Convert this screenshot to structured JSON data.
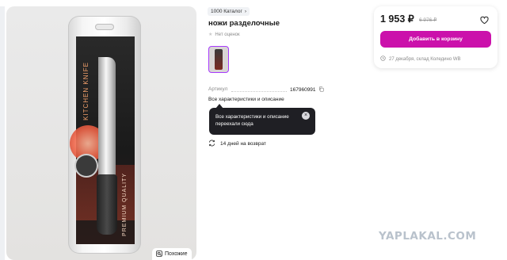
{
  "breadcrumb": {
    "label": "1000 Каталог"
  },
  "product": {
    "title": "ножи разделочные",
    "reviews_text": "Нет оценок",
    "sku_label": "Артикул",
    "sku_value": "167960991",
    "all_specs_link": "Все характеристики и описание",
    "returns_text": "14 дней на возврат"
  },
  "tooltip": {
    "text": "Все характеристики и описание переехали сюда"
  },
  "gallery": {
    "similar_button": "Похожие",
    "package_texts": [
      "KITCHEN KNIFE",
      "PREMIUM QUALITY"
    ]
  },
  "price_card": {
    "price": "1 953 ₽",
    "old_price": "6 976 ₽",
    "cart_button": "Добавить в корзину",
    "delivery": "27 декабря, склад Коледино WB"
  },
  "watermark": "YAPLAKAL.COM",
  "colors": {
    "accent": "#cb11ab",
    "thumb_border": "#a73afd",
    "tooltip_bg": "#1f1f24"
  }
}
